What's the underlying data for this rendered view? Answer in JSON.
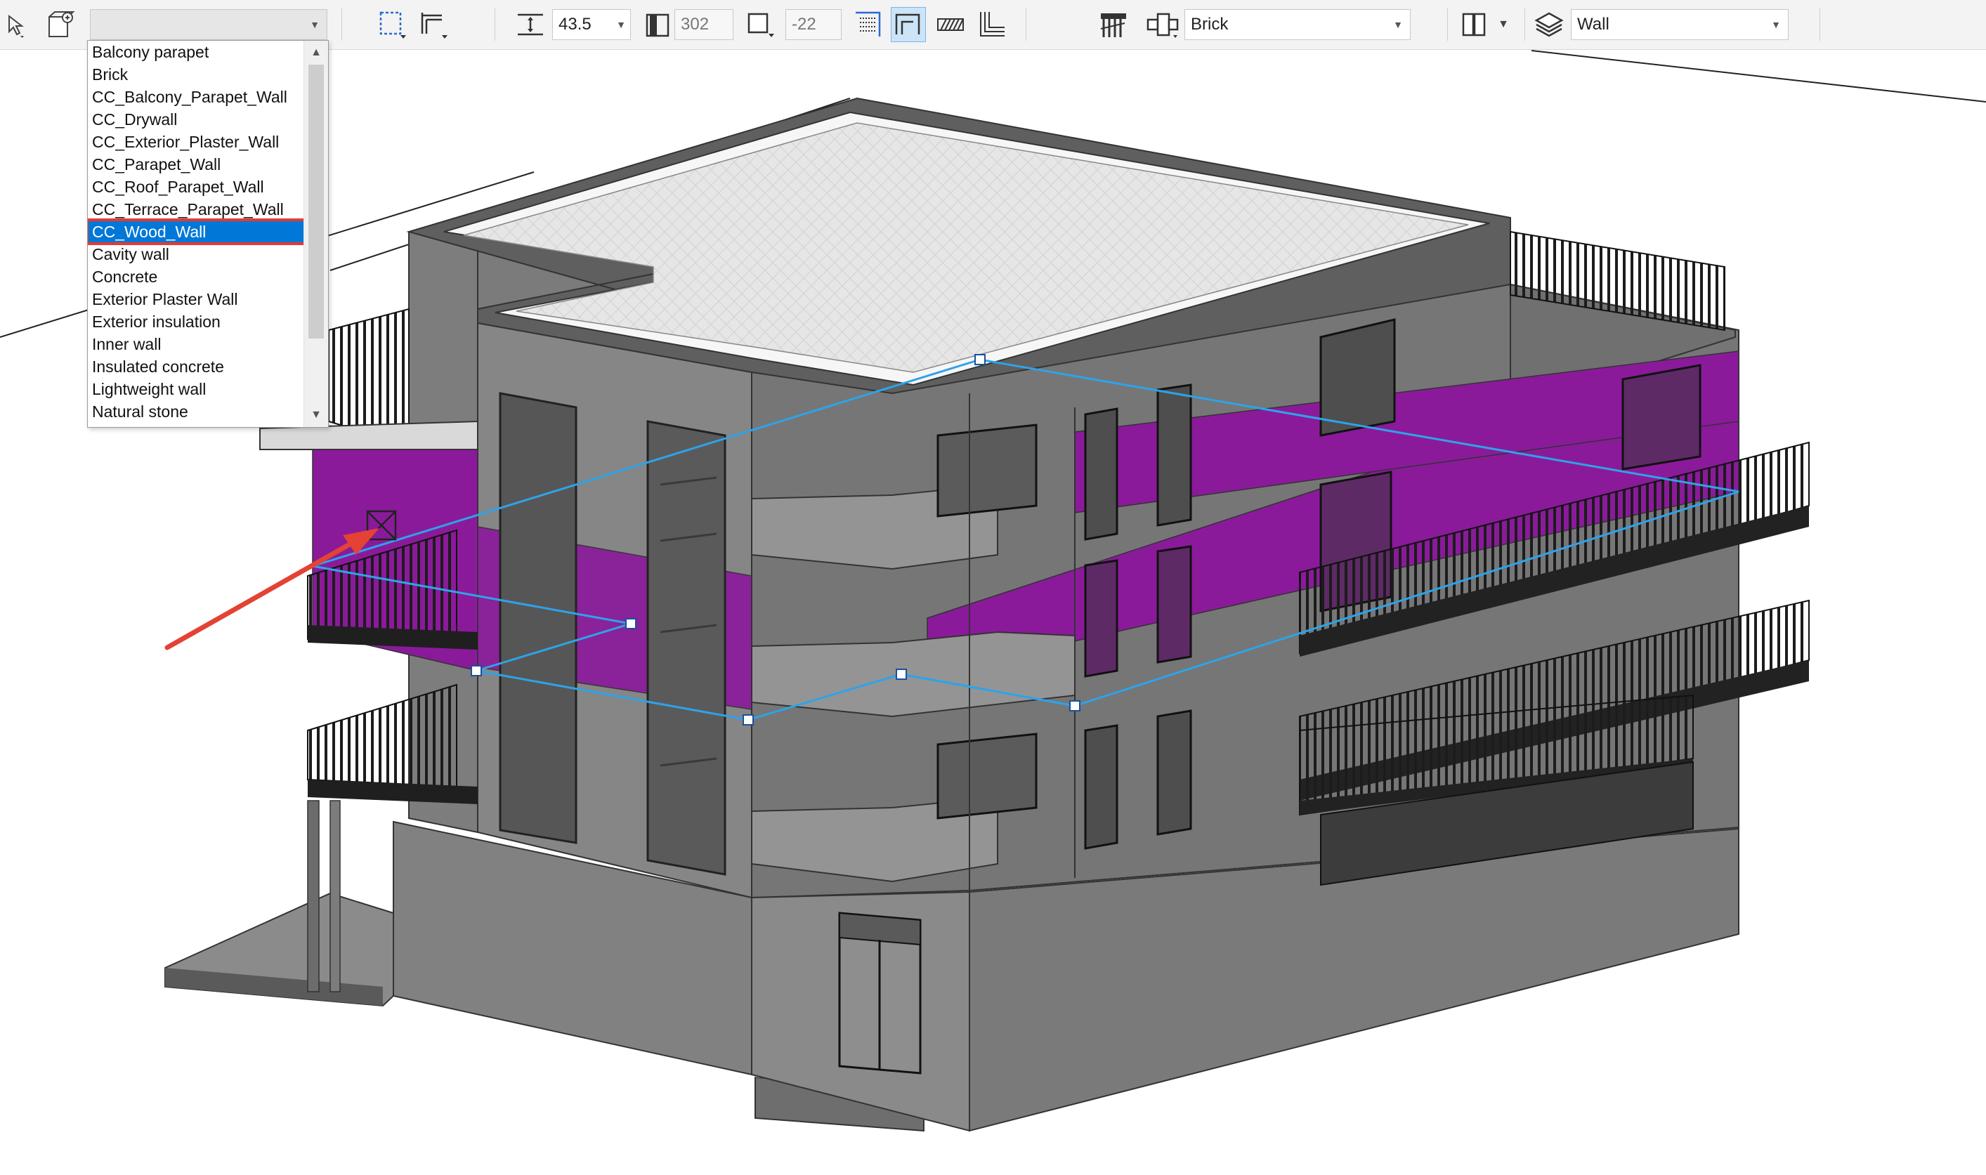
{
  "toolbar": {
    "material_combo_value": "",
    "thickness_value": "43.5",
    "height_value": "302",
    "offset_value": "-22",
    "surface_value": "Brick",
    "layer_value": "Wall"
  },
  "dropdown": {
    "items": [
      "Balcony parapet",
      "Brick",
      "CC_Balcony_Parapet_Wall",
      "CC_Drywall",
      "CC_Exterior_Plaster_Wall",
      "CC_Parapet_Wall",
      "CC_Roof_Parapet_Wall",
      "CC_Terrace_Parapet_Wall",
      "CC_Wood_Wall",
      "Cavity wall",
      "Concrete",
      "Exterior Plaster Wall",
      "Exterior insulation",
      "Inner wall",
      "Insulated concrete",
      "Lightweight wall",
      "Natural stone"
    ],
    "selected_index": 8
  },
  "colors": {
    "accent_selection": "#0078d7",
    "highlight_frame": "#e53935",
    "wall_highlight": "#8b1a9b",
    "concrete": "#7a7a7a",
    "guide_line": "#2ea3e8"
  },
  "icons": {
    "cursor": "mouse-pointer-icon",
    "annotation": "red-arrow-annotation"
  }
}
